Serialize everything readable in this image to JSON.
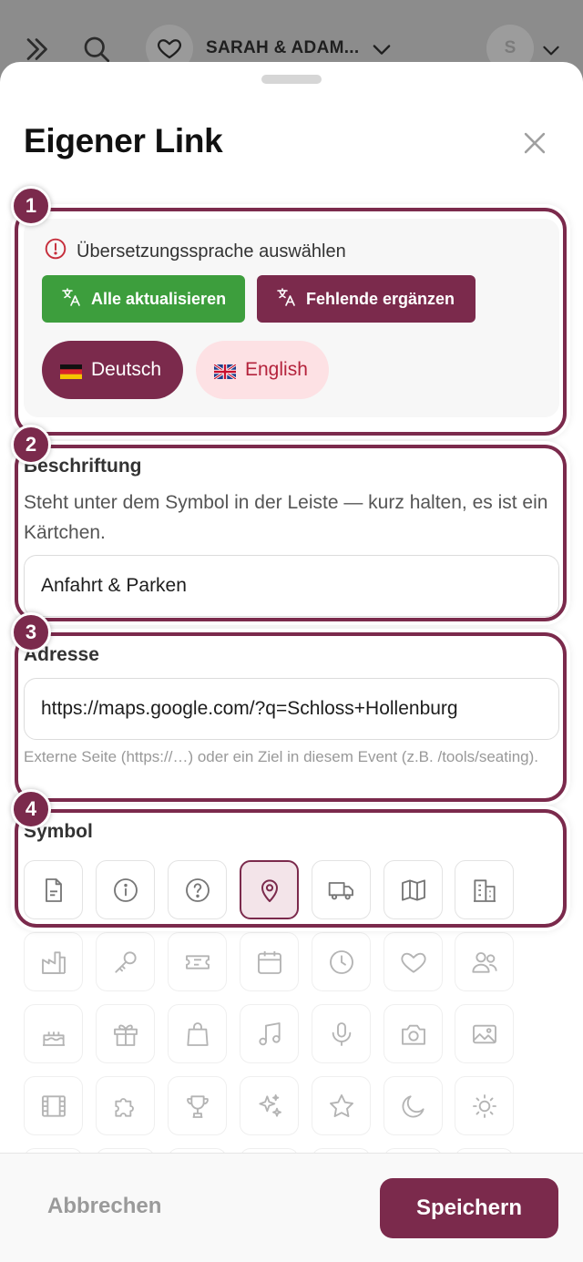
{
  "topbar": {
    "event_title": "SARAH & ADAM...",
    "avatar_initial": "S"
  },
  "sheet": {
    "title": "Eigener Link"
  },
  "translation": {
    "warning": "Übersetzungssprache auswählen",
    "update_all": "Alle aktualisieren",
    "fill_missing": "Fehlende ergänzen",
    "languages": [
      {
        "label": "Deutsch",
        "selected": true
      },
      {
        "label": "English",
        "selected": false
      }
    ]
  },
  "label_section": {
    "label": "Beschriftung",
    "help": "Steht unter dem Symbol in der Leiste — kurz halten, es ist ein Kärtchen.",
    "value": "Anfahrt & Parken"
  },
  "address_section": {
    "label": "Adresse",
    "value": "https://maps.google.com/?q=Schloss+Hollenburg",
    "help": "Externe Seite (https://…) oder ein Ziel in diesem Event (z.B. /tools/seating)."
  },
  "symbol_section": {
    "label": "Symbol",
    "selected": "map-pin",
    "icons": [
      "document",
      "info",
      "help",
      "map-pin",
      "truck",
      "map",
      "building",
      "factory",
      "key",
      "ticket",
      "calendar",
      "clock",
      "heart",
      "users",
      "cake",
      "gift",
      "shopping-bag",
      "music",
      "microphone",
      "camera",
      "image",
      "film",
      "puzzle",
      "trophy",
      "sparkles",
      "star",
      "moon",
      "sun"
    ]
  },
  "highlights": [
    "1",
    "2",
    "3",
    "4"
  ],
  "footer": {
    "cancel": "Abbrechen",
    "save": "Speichern"
  },
  "colors": {
    "accent": "#7b2a4c",
    "green": "#3d9e3d",
    "english_bg": "#fde1e4"
  }
}
